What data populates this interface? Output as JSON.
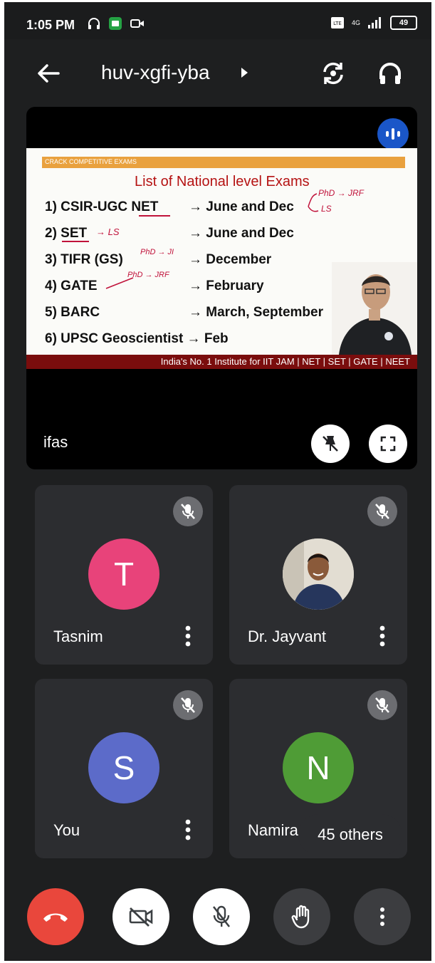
{
  "status_bar": {
    "time": "1:05 PM",
    "network": "4G",
    "battery": "49"
  },
  "header": {
    "meeting_code": "huv-xgfi-yba"
  },
  "presentation": {
    "presenter_name": "ifas",
    "slide": {
      "banner": "CRACK COMPETITIVE EXAMS",
      "heading": "List of National level Exams",
      "items": [
        {
          "exam": "1) CSIR-UGC NET",
          "when": "→ June and Dec"
        },
        {
          "exam": "2) SET",
          "when": "→ June and Dec"
        },
        {
          "exam": "3) TIFR (GS)",
          "when": "→ December"
        },
        {
          "exam": "4) GATE",
          "when": "→ February"
        },
        {
          "exam": "5) BARC",
          "when": "→ March, September"
        },
        {
          "exam": "6) UPSC Geoscientist → Feb",
          "when": ""
        }
      ],
      "annotations": {
        "net_top": "PhD → JRF",
        "net_bottom": "LS",
        "set": "→ LS",
        "tifr": "PhD → JI",
        "gate": "PhD → JRF"
      },
      "footer": "India's No. 1 Institute for IIT JAM | NET | SET | GATE | NEET"
    }
  },
  "participants": [
    {
      "name": "Tasnim",
      "initial": "T",
      "avatar_color": "#e8437a",
      "muted": true
    },
    {
      "name": "Dr. Jayvant",
      "initial": "",
      "avatar_color": "#d8d2c6",
      "muted": true
    },
    {
      "name": "You",
      "initial": "S",
      "avatar_color": "#5c6bc9",
      "muted": true
    },
    {
      "name": "Namira",
      "initial": "N",
      "avatar_color": "#4f9c36",
      "muted": true
    }
  ],
  "others_label": "45 others",
  "controls": {
    "end_call_color": "#e9473c",
    "button_color": "#ffffff",
    "dark_button_color": "#3c3d40"
  }
}
